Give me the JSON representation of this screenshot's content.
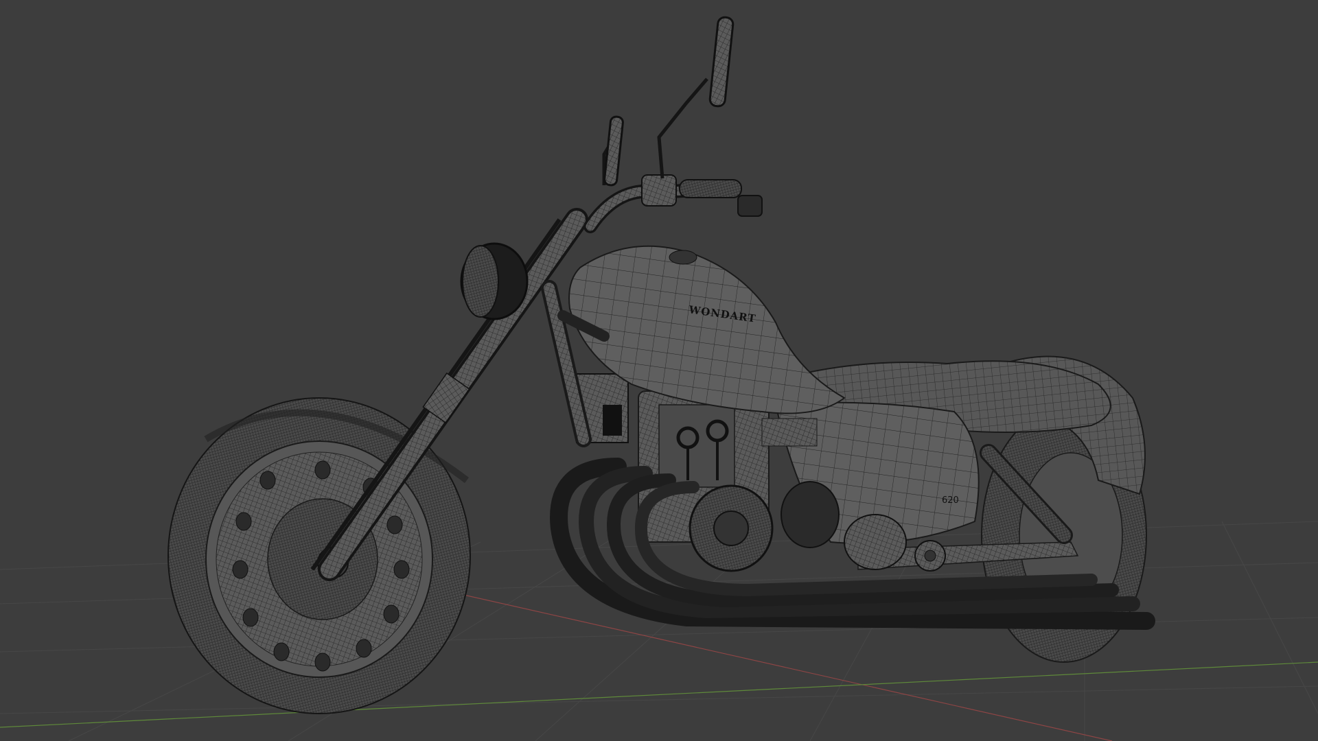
{
  "viewport": {
    "background": "#3d3d3d",
    "grid_color": "#4a4a4a",
    "x_axis_color": "#b44a4a",
    "y_axis_color": "#6a9a3a"
  },
  "model": {
    "tank_logo": "WONDART",
    "render_mode": "wireframe",
    "wire_color": "#1e1e1e"
  }
}
